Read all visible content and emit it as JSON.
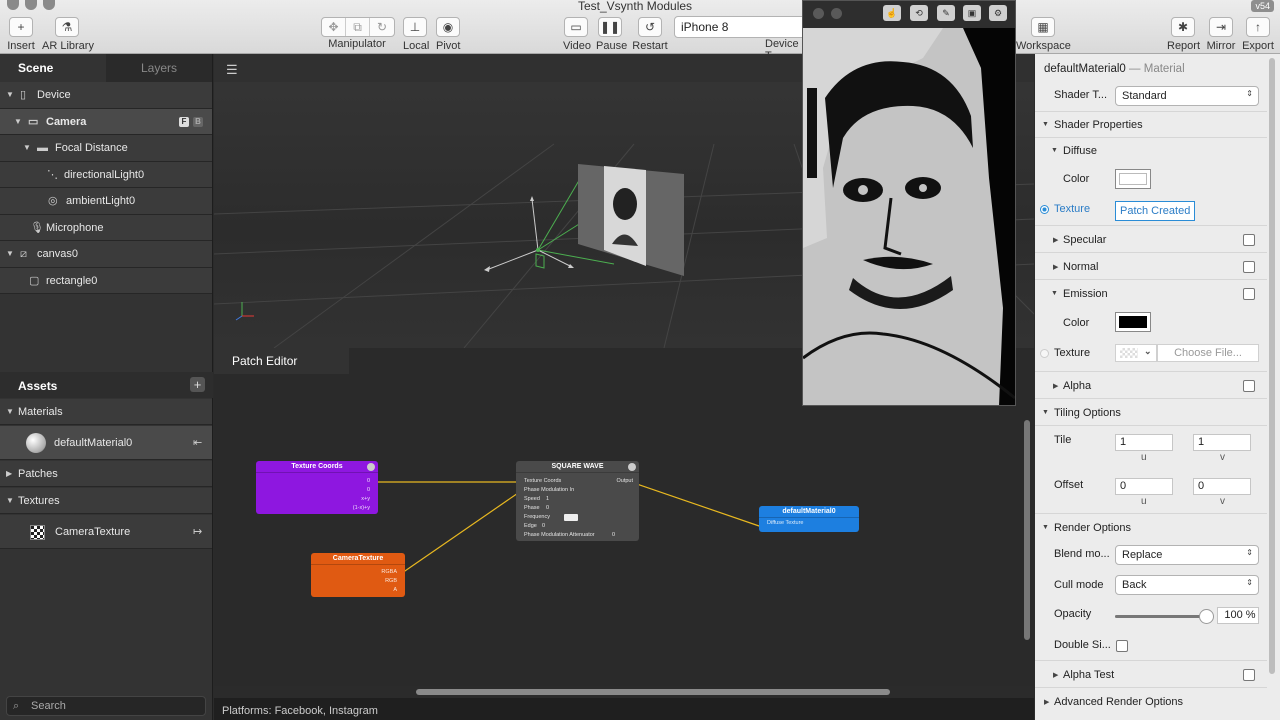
{
  "window": {
    "title": "Test_Vsynth Modules",
    "version": "v54"
  },
  "toolbar": {
    "insert": "Insert",
    "ar_library": "AR Library",
    "manipulator": "Manipulator",
    "local": "Local",
    "pivot": "Pivot",
    "video": "Video",
    "pause": "Pause",
    "restart": "Restart",
    "device_value": "iPhone 8",
    "device_label": "Device T",
    "workspace": "Workspace",
    "report": "Report",
    "mirror": "Mirror",
    "export": "Export"
  },
  "left_panel": {
    "tabs": [
      "Scene",
      "Layers"
    ],
    "scene_tree": [
      {
        "label": "Device",
        "icon": "device-icon"
      },
      {
        "label": "Camera",
        "icon": "camera-icon",
        "badges": [
          "F",
          "B"
        ]
      },
      {
        "label": "Focal Distance",
        "icon": "focal-distance-icon"
      },
      {
        "label": "directionalLight0",
        "icon": "directional-light-icon"
      },
      {
        "label": "ambientLight0",
        "icon": "ambient-light-icon"
      },
      {
        "label": "Microphone",
        "icon": "microphone-icon"
      },
      {
        "label": "canvas0",
        "icon": "canvas-icon"
      },
      {
        "label": "rectangle0",
        "icon": "rectangle-icon"
      }
    ],
    "assets_title": "Assets",
    "assets": {
      "materials_label": "Materials",
      "material_item": "defaultMaterial0",
      "patches_label": "Patches",
      "textures_label": "Textures",
      "texture_item": "CameraTexture"
    },
    "search_placeholder": "Search"
  },
  "patch_editor": {
    "tab": "Patch Editor",
    "nodes": {
      "texture_coords": {
        "title": "Texture Coords",
        "ports": [
          "0",
          "0",
          "x+y",
          "(1-x)+y"
        ]
      },
      "camera_texture": {
        "title": "CameraTexture",
        "ports": [
          "RGBA",
          "RGB",
          "A"
        ]
      },
      "square_wave": {
        "title": "SQUARE WAVE",
        "inputs": [
          "Texture Coords",
          "Phase Modulation In",
          "Speed",
          "Phase",
          "Frequency",
          "Edge",
          "Phase Modulation Attenuator"
        ],
        "input_values": {
          "speed": "1",
          "phase": "0",
          "frequency": "",
          "edge": "0",
          "attenuator": "0"
        },
        "output": "Output"
      },
      "default_material": {
        "title": "defaultMaterial0",
        "port": "Diffuse Texture"
      }
    },
    "colors": {
      "texture_coords": "#8e17e0",
      "camera_texture": "#e05a12",
      "square_wave": "#4a4a4a",
      "default_material": "#1d7fe0",
      "wire": "#e8b820"
    }
  },
  "status_bar": "Platforms: Facebook, Instagram",
  "inspector": {
    "title": "defaultMaterial0",
    "subtitle": "Material",
    "shader_type_label": "Shader T...",
    "shader_type_value": "Standard",
    "shader_properties": "Shader Properties",
    "diffuse": "Diffuse",
    "diffuse_color_label": "Color",
    "diffuse_color": "#ffffff",
    "texture_label": "Texture",
    "texture_value": "Patch Created",
    "specular": "Specular",
    "normal": "Normal",
    "emission": "Emission",
    "emission_color_label": "Color",
    "emission_color": "#000000",
    "emission_texture_label": "Texture",
    "choose_file": "Choose File...",
    "alpha": "Alpha",
    "tiling_options": "Tiling Options",
    "tile_label": "Tile",
    "tile_u": "1",
    "tile_v": "1",
    "offset_label": "Offset",
    "offset_u": "0",
    "offset_v": "0",
    "unit_u": "u",
    "unit_v": "v",
    "render_options": "Render Options",
    "blend_mode_label": "Blend mo...",
    "blend_mode_value": "Replace",
    "cull_mode_label": "Cull mode",
    "cull_mode_value": "Back",
    "opacity_label": "Opacity",
    "opacity_value": "100 %",
    "opacity_level": 1.0,
    "double_sided_label": "Double Si...",
    "alpha_test": "Alpha Test",
    "advanced_render_options": "Advanced Render Options"
  }
}
